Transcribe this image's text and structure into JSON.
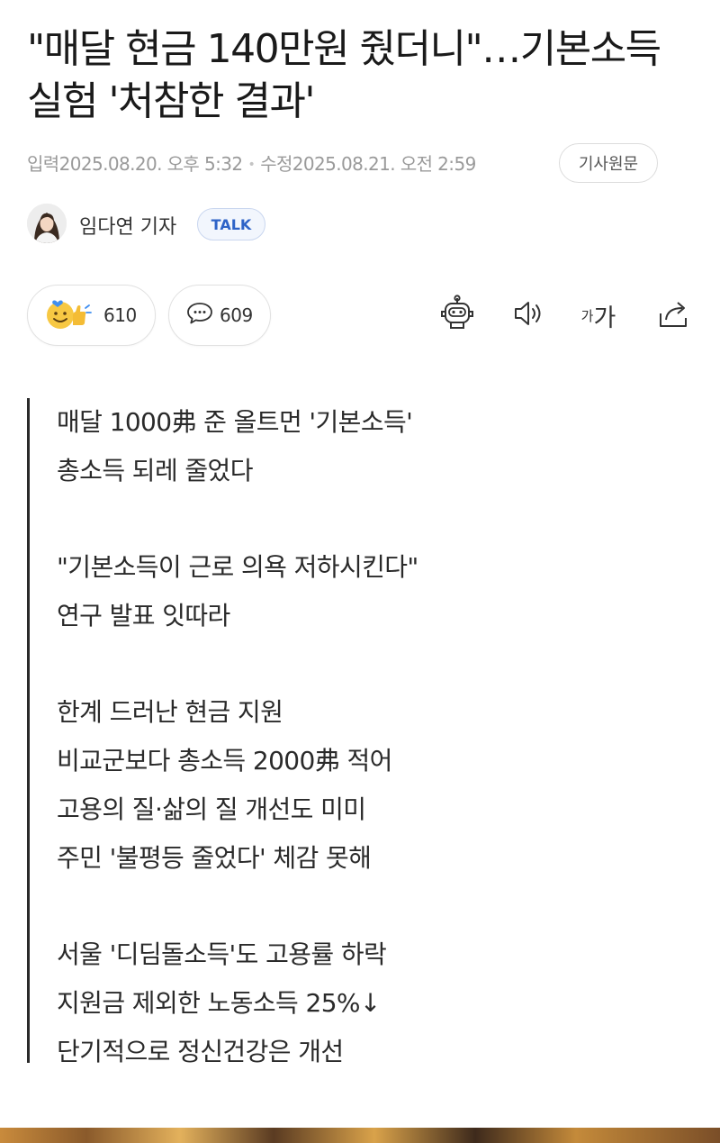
{
  "article": {
    "title": "\"매달 현금 140만원 줬더니\"…기본소득 실험 '처참한 결과'",
    "input_label": "입력",
    "input_date": "2025.08.20. 오후 5:32",
    "modified_label": "수정",
    "modified_date": "2025.08.21. 오전 2:59",
    "original_button": "기사원문"
  },
  "author": {
    "name": "임다연 기자",
    "talk_button": "TALK"
  },
  "actions": {
    "reaction_count": "610",
    "comment_count": "609",
    "font_small": "가",
    "font_large": "가"
  },
  "summary": {
    "lines": [
      "매달 1000弗 준 올트먼 '기본소득'",
      "총소득 되레 줄었다",
      "",
      "\"기본소득이 근로 의욕 저하시킨다\"",
      "연구 발표 잇따라",
      "",
      "한계 드러난 현금 지원",
      "비교군보다 총소득 2000弗 적어",
      "고용의 질·삶의 질 개선도 미미",
      "주민 '불평등 줄었다' 체감 못해",
      "",
      "서울 '디딤돌소득'도 고용률 하락",
      "지원금 제외한 노동소득 25%↓",
      "단기적으로 정신건강은 개선"
    ]
  },
  "icons": {
    "reaction": "smile-thumbs-up-icon",
    "comment": "speech-bubble-icon",
    "ai_summary": "robot-icon",
    "listen": "speaker-icon",
    "share": "share-icon"
  },
  "colors": {
    "talk_accent": "#2e63c7",
    "emoji_yellow": "#f7c843",
    "heart_blue": "#3f8ef0",
    "summary_bar": "#2a2a2a"
  }
}
